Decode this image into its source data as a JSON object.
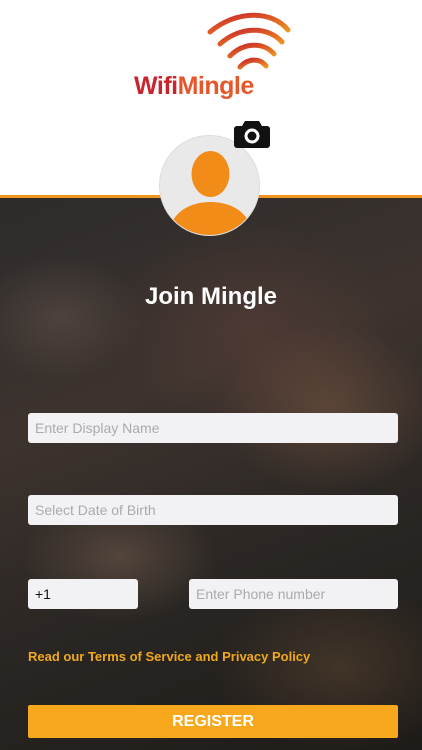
{
  "brand": {
    "part1": "Wifi",
    "part2": "Mingle",
    "colors": {
      "primary": "#e7572a",
      "accent": "#f7a81c",
      "wifi_gradient_start": "#c9252c",
      "wifi_gradient_end": "#f0961e"
    }
  },
  "profile": {
    "avatar_icon": "person-silhouette-icon",
    "camera_icon": "camera-icon"
  },
  "page": {
    "title": "Join Mingle"
  },
  "form": {
    "display_name": {
      "placeholder": "Enter Display Name",
      "value": ""
    },
    "dob": {
      "placeholder": "Select Date of Birth",
      "value": ""
    },
    "country_code": {
      "value": "+1"
    },
    "phone": {
      "placeholder": "Enter Phone number",
      "value": ""
    }
  },
  "terms_link": "Read our Terms of Service and Privacy Policy",
  "register_label": "REGISTER"
}
